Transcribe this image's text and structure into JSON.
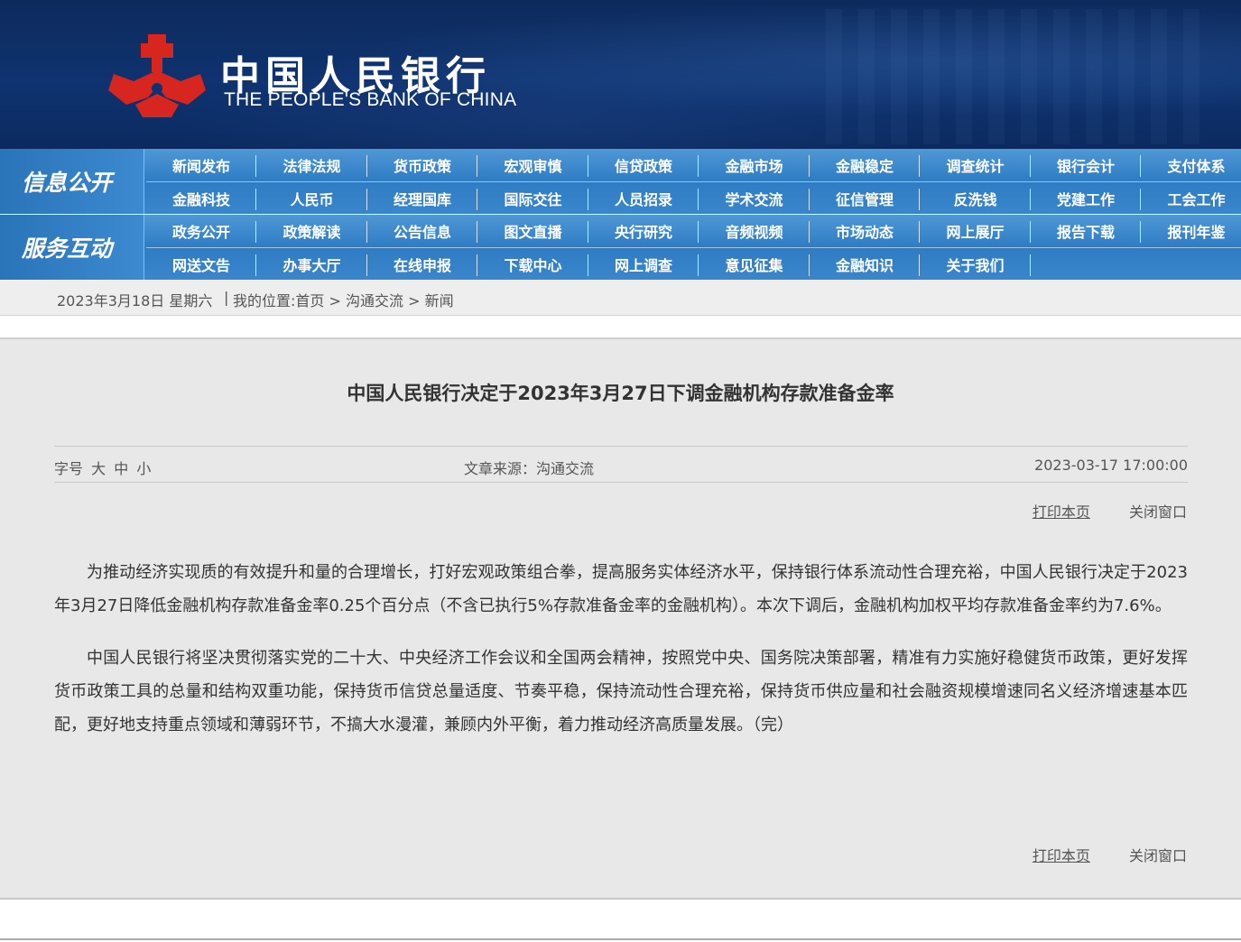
{
  "header": {
    "cn_name": "中国人民银行",
    "en_name": "THE PEOPLE'S BANK OF CHINA",
    "logo_color": "#d7251f",
    "banner_color": "#0f3370"
  },
  "nav": {
    "accent": "#2f7cc4",
    "row1": {
      "category": "信息公开",
      "items": [
        "新闻发布",
        "法律法规",
        "货币政策",
        "宏观审慎",
        "信贷政策",
        "金融市场",
        "金融稳定",
        "调查统计",
        "银行会计",
        "支付体系",
        "金融科技",
        "人民币",
        "经理国库",
        "国际交往",
        "人员招录",
        "学术交流",
        "征信管理",
        "反洗钱",
        "党建工作",
        "工会工作"
      ]
    },
    "row2": {
      "category": "服务互动",
      "items": [
        "政务公开",
        "政策解读",
        "公告信息",
        "图文直播",
        "央行研究",
        "音频视频",
        "市场动态",
        "网上展厅",
        "报告下载",
        "报刊年鉴",
        "网送文告",
        "办事大厅",
        "在线申报",
        "下载中心",
        "网上调查",
        "意见征集",
        "金融知识",
        "关于我们"
      ]
    }
  },
  "breadcrumb": {
    "date": "2023年3月18日 星期六",
    "separator": "|",
    "location_label": "我的位置:",
    "path": [
      "首页",
      "沟通交流",
      "新闻"
    ]
  },
  "article": {
    "title": "中国人民银行决定于2023年3月27日下调金融机构存款准备金率",
    "font_size_label": "字号",
    "font_size_large": "大",
    "font_size_medium": "中",
    "font_size_small": "小",
    "source": "文章来源：沟通交流",
    "datetime": "2023-03-17 17:00:00",
    "print_label": "打印本页",
    "close_label": "关闭窗口",
    "paragraphs": [
      "为推动经济实现质的有效提升和量的合理增长，打好宏观政策组合拳，提高服务实体经济水平，保持银行体系流动性合理充裕，中国人民银行决定于2023年3月27日降低金融机构存款准备金率0.25个百分点（不含已执行5%存款准备金率的金融机构）。本次下调后，金融机构加权平均存款准备金率约为7.6%。",
      "中国人民银行将坚决贯彻落实党的二十大、中央经济工作会议和全国两会精神，按照党中央、国务院决策部署，精准有力实施好稳健货币政策，更好发挥货币政策工具的总量和结构双重功能，保持货币信贷总量适度、节奏平稳，保持流动性合理充裕，保持货币供应量和社会融资规模增速同名义经济增速基本匹配，更好地支持重点领域和薄弱环节，不搞大水漫灌，兼顾内外平衡，着力推动经济高质量发展。（完）"
    ]
  }
}
